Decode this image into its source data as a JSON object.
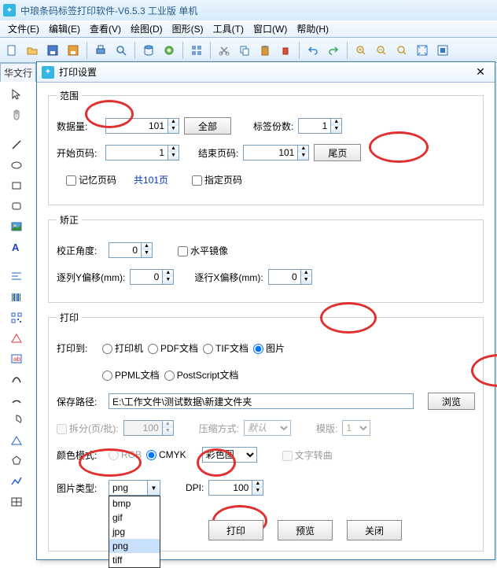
{
  "app": {
    "title": "中琅条码标签打印软件-V6.5.3 工业版 单机"
  },
  "menu": {
    "file": "文件(E)",
    "edit": "编辑(E)",
    "view": "查看(V)",
    "draw": "绘图(D)",
    "shape": "图形(S)",
    "tool": "工具(T)",
    "window": "窗口(W)",
    "help": "帮助(H)"
  },
  "bg_tab": "华文行",
  "dialog": {
    "title": "打印设置",
    "range": {
      "legend": "范围",
      "data_count_label": "数据量:",
      "data_count": "101",
      "all_btn": "全部",
      "copies_label": "标签份数:",
      "copies": "1",
      "start_page_label": "开始页码:",
      "start_page": "1",
      "end_page_label": "结束页码:",
      "end_page": "101",
      "last_page_btn": "尾页",
      "remember_page": "记忆页码",
      "total_pages": "共101页",
      "specify_page": "指定页码"
    },
    "correct": {
      "legend": "矫正",
      "angle_label": "校正角度:",
      "angle": "0",
      "hmirror": "水平镜像",
      "y_offset_label": "逐列Y偏移(mm):",
      "y_offset": "0",
      "x_offset_label": "逐行X偏移(mm):",
      "x_offset": "0"
    },
    "print": {
      "legend": "打印",
      "to_label": "打印到:",
      "opt_printer": "打印机",
      "opt_pdf": "PDF文档",
      "opt_tif": "TIF文档",
      "opt_image": "图片",
      "opt_ppml": "PPML文档",
      "opt_ps": "PostScript文档",
      "save_path_label": "保存路径:",
      "save_path": "E:\\工作文件\\测试数据\\新建文件夹",
      "browse_btn": "浏览",
      "split_label": "拆分(页/批):",
      "split_value": "100",
      "compress_label": "压缩方式:",
      "compress_value": "默认",
      "template_label": "模版:",
      "template_value": "1",
      "color_label": "颜色模式:",
      "color_rgb": "RGB",
      "color_cmyk": "CMYK",
      "color_select": "彩色图",
      "text_curve": "文字转曲",
      "img_type_label": "图片类型:",
      "img_type_value": "png",
      "img_type_options": [
        "bmp",
        "gif",
        "jpg",
        "png",
        "tiff"
      ],
      "dpi_label": "DPI:",
      "dpi_value": "100"
    },
    "footer": {
      "print": "打印",
      "preview": "预览",
      "close": "关闭"
    }
  }
}
